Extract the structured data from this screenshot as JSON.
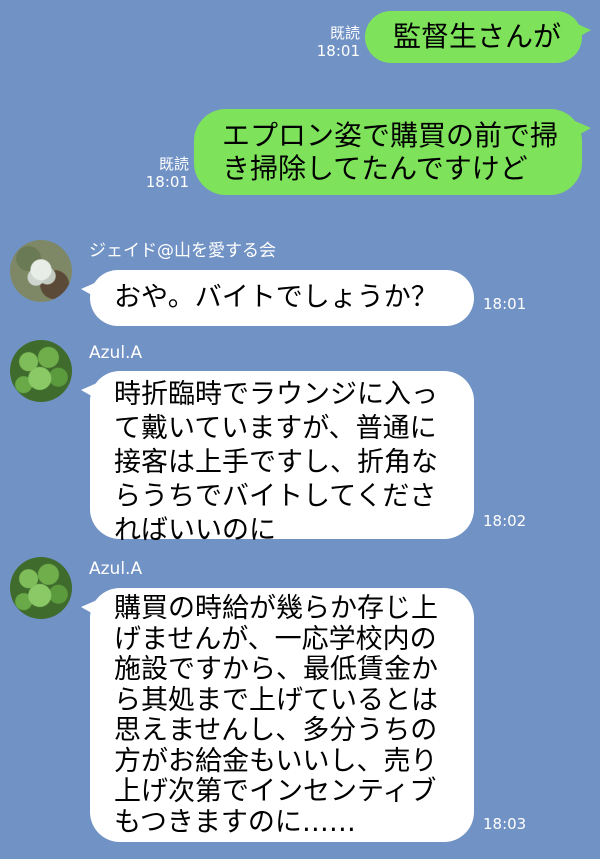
{
  "messages": {
    "out1": {
      "read": "既読",
      "time": "18:01",
      "text": "監督生さんが"
    },
    "out2": {
      "read": "既読",
      "time": "18:01",
      "lines": [
        "エプロン姿で購買の前で掃",
        "き掃除してたんですけど"
      ]
    },
    "in1": {
      "sender": "ジェイド@山を愛する会",
      "avatar": "jade-avatar",
      "time": "18:01",
      "text": "おや。バイトでしょうか？"
    },
    "in2": {
      "sender": "Azul.A",
      "avatar": "clover-avatar",
      "time": "18:02",
      "lines": [
        "時折臨時でラウンジに入っ",
        "て戴いていますが、普通に",
        "接客は上手ですし、折角な",
        "らうちでバイトしてくださ",
        "ればいいのに"
      ]
    },
    "in3": {
      "sender": "Azul.A",
      "avatar": "clover-avatar",
      "time": "18:03",
      "lines": [
        "購買の時給が幾らか存じ上",
        "げませんが、一応学校内の",
        "施設ですから、最低賃金か",
        "ら其処まで上げているとは",
        "思えませんし、多分うちの",
        "方がお給金もいいし、売り",
        "上げ次第でインセンティブ",
        "もつきますのに……"
      ]
    }
  },
  "colors": {
    "background": "#7192c4",
    "outgoing": "#7ee35b",
    "incoming": "#ffffff"
  }
}
